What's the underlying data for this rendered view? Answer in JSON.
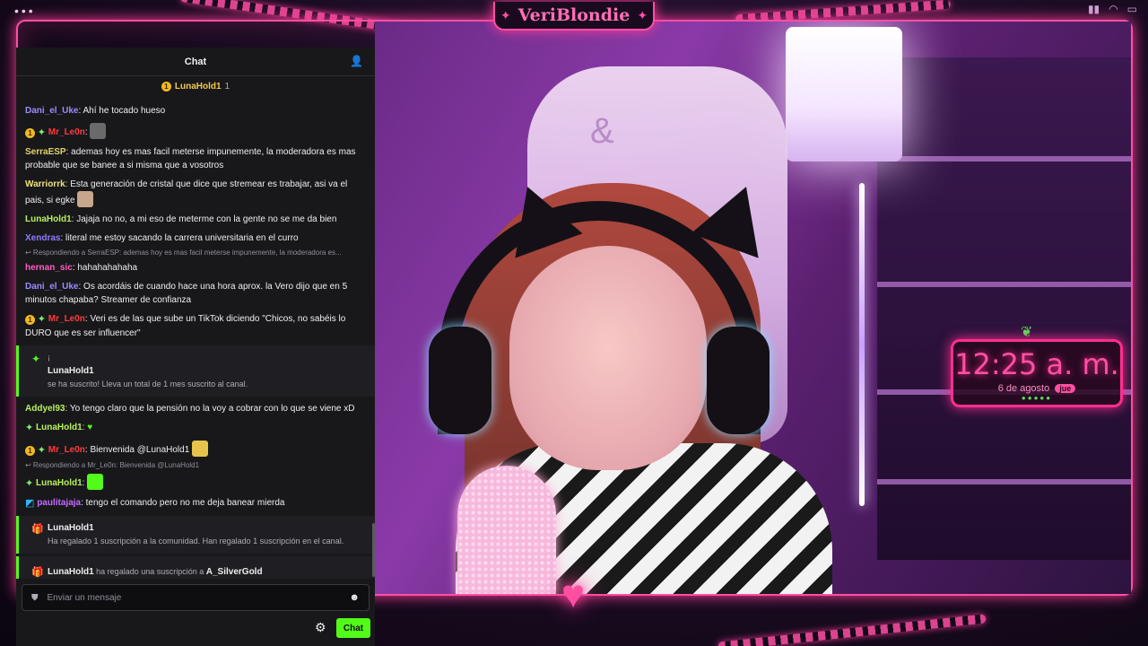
{
  "stream": {
    "channel_name": "VeriBlondie",
    "clock_time": "12:25 a. m.",
    "clock_date": "6 de agosto",
    "clock_day": "jue"
  },
  "chat": {
    "title": "Chat",
    "pinned": {
      "name": "LunaHold1",
      "count": "1"
    },
    "messages": [
      {
        "user": "Dani_el_Uke",
        "color": "#9b8cff",
        "text": "Ahí he tocado hueso"
      },
      {
        "user": "Mr_Le0n",
        "color": "#ff3b3b",
        "text": "",
        "badges": true,
        "emote": "#6a6a6a"
      },
      {
        "user": "SerraESP",
        "color": "#e3d26b",
        "text": "ademas hoy es mas facil meterse impunemente, la moderadora es mas probable que se banee a si misma que a vosotros"
      },
      {
        "user": "Warriorrk",
        "color": "#f2e27a",
        "text": "Esta generación de cristal que dice que stremear es trabajar, asi va el pais, si egke",
        "emote": "#c8a68c"
      },
      {
        "user": "LunaHold1",
        "color": "#b6f25a",
        "text": "Jajaja no no, a mi eso de meterme con la gente no se me da bien"
      },
      {
        "user": "Xendras",
        "color": "#8f7cff",
        "text": "literal me estoy sacando la carrera universitaria en el curro"
      }
    ],
    "reply1": "Respondiendo a SerraESP: ademas hoy es mas facil meterse impunemente, la moderadora es...",
    "messages2": [
      {
        "user": "hernan_sic",
        "color": "#ff5ec4",
        "text": "hahahahahaha"
      },
      {
        "user": "Dani_el_Uke",
        "color": "#9b8cff",
        "text": "Os acordáis de cuando hace una hora aprox. la Vero dijo que en 5 minutos chapaba? Streamer de confianza"
      },
      {
        "user": "Mr_Le0n",
        "color": "#ff3b3b",
        "text": "Veri es de las que sube un TikTok diciendo \"Chicos, no sabéis lo DURO que es ser influencer\"",
        "badges": true
      }
    ],
    "sub_event": {
      "small": "¡",
      "user": "LunaHold1",
      "text": "se ha suscrito! Lleva un total de 1 mes suscrito al canal."
    },
    "messages3": [
      {
        "user": "Addyel93",
        "color": "#b6f25a",
        "text": "Yo tengo claro que la pensión no la voy a cobrar con lo que se viene xD"
      },
      {
        "user": "LunaHold1",
        "color": "#b6f25a",
        "text": "♥",
        "gem": true
      },
      {
        "user": "Mr_Le0n",
        "color": "#ff3b3b",
        "text": "Bienvenida @LunaHold1",
        "badges": true,
        "emote": "#e6c34a"
      }
    ],
    "reply2": "Respondiendo a Mr_Le0n: Bienvenida @LunaHold1",
    "messages4": [
      {
        "user": "LunaHold1",
        "color": "#b6f25a",
        "text": "",
        "gem": true,
        "emote": "#53fc18"
      },
      {
        "user": "paulitajaja",
        "color": "#c46bff",
        "text": "tengo el comando pero no me deja banear mierda",
        "kick": true
      }
    ],
    "gift_event": {
      "user": "LunaHold1",
      "text": "Ha regalado 1 suscripción a la comunidad. Han regalado 1 suscripción en el canal."
    },
    "gift_event2": {
      "user": "LunaHold1",
      "middle": "ha regalado una suscripción a",
      "target": "A_SilverGold"
    },
    "input_placeholder": "Enviar un mensaje",
    "send_label": "Chat"
  },
  "colors": {
    "accent": "#53fc18",
    "neon": "#ff4fa3"
  }
}
